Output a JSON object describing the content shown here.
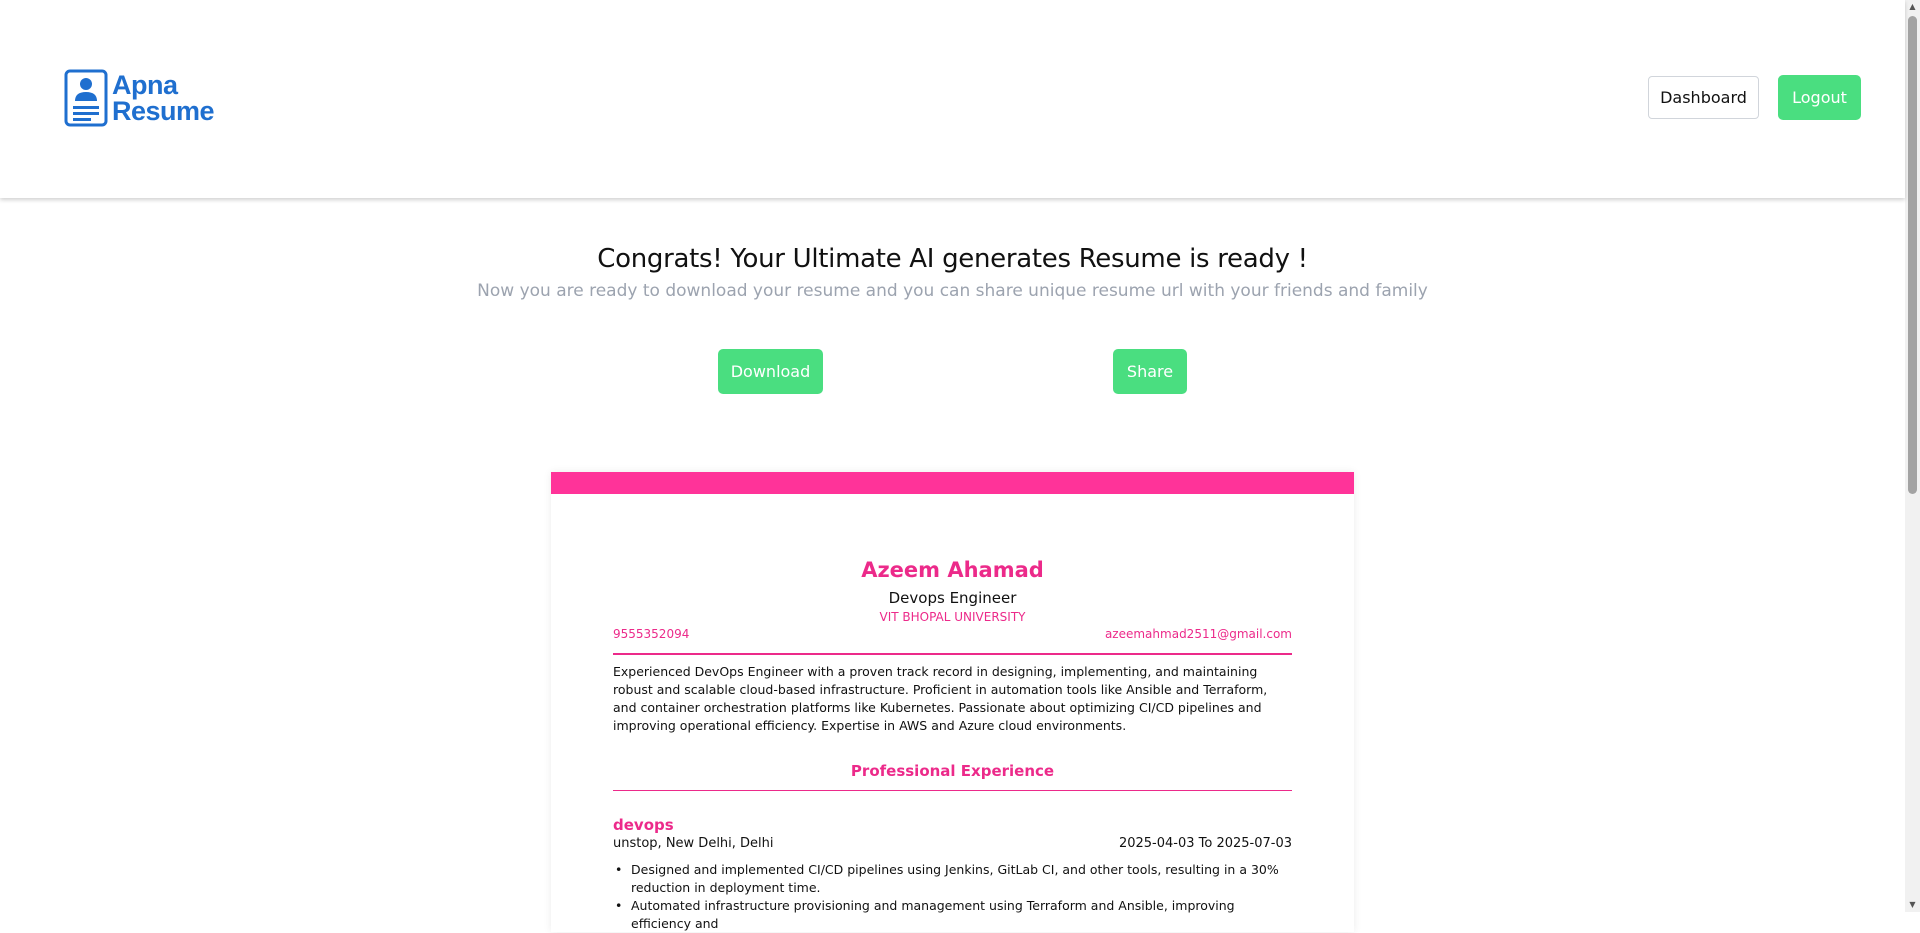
{
  "header": {
    "logo": {
      "line1": "Apna",
      "line2": "Resume",
      "icon": "resume-document-icon"
    },
    "dashboard_label": "Dashboard",
    "logout_label": "Logout"
  },
  "main": {
    "title": "Congrats! Your Ultimate AI generates Resume is ready !",
    "subtitle": "Now you are ready to download your resume and you can share unique resume url with your friends and family",
    "download_label": "Download",
    "share_label": "Share"
  },
  "resume": {
    "accent_color": "#ff3399",
    "name": "Azeem Ahamad",
    "role": "Devops Engineer",
    "university": "VIT BHOPAL UNIVERSITY",
    "phone": "9555352094",
    "email": "azeemahmad2511@gmail.com",
    "summary": "Experienced DevOps Engineer with a proven track record in designing, implementing, and maintaining robust and scalable cloud-based infrastructure. Proficient in automation tools like Ansible and Terraform, and container orchestration platforms like Kubernetes. Passionate about optimizing CI/CD pipelines and improving operational efficiency. Expertise in AWS and Azure cloud environments.",
    "experience_heading": "Professional Experience",
    "jobs": [
      {
        "title": "devops",
        "company": "unstop, New Delhi, Delhi",
        "dates": "2025-04-03 To 2025-07-03",
        "bullets": [
          "Designed and implemented CI/CD pipelines using Jenkins, GitLab CI, and other tools, resulting in a 30% reduction in deployment time.",
          "Automated infrastructure provisioning and management using Terraform and Ansible, improving efficiency and"
        ]
      }
    ]
  }
}
